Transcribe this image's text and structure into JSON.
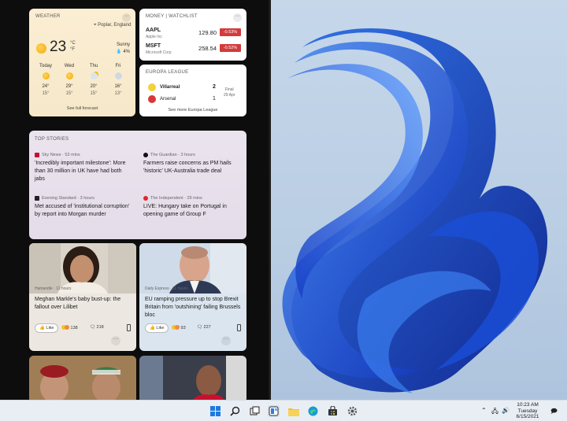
{
  "weather": {
    "header": "WEATHER",
    "location": "Poplar, England",
    "temp": "23",
    "unit_c": "°C",
    "unit_f": "°F",
    "condition": "Sunny",
    "precip": "4%",
    "forecast": [
      {
        "day": "Today",
        "icon": "sun-icon",
        "high": "24°",
        "low": "15°"
      },
      {
        "day": "Wed",
        "icon": "sun-icon",
        "high": "29°",
        "low": "15°"
      },
      {
        "day": "Thu",
        "icon": "partly-cloudy-icon",
        "high": "20°",
        "low": "15°"
      },
      {
        "day": "Fri",
        "icon": "rain-cloud-icon",
        "high": "16°",
        "low": "13°"
      }
    ],
    "link": "See full forecast"
  },
  "money": {
    "header": "MONEY | WATCHLIST",
    "stocks": [
      {
        "symbol": "AAPL",
        "name": "Apple Inc",
        "price": "129.80",
        "change": "-0.53%"
      },
      {
        "symbol": "MSFT",
        "name": "Microsoft Corp",
        "price": "258.54",
        "change": "-0.52%"
      }
    ],
    "down_color": "#d23b3b"
  },
  "sports": {
    "header": "EUROPA LEAGUE",
    "home": "Villarreal",
    "home_score": "2",
    "away": "Arsenal",
    "away_score": "1",
    "status": "Final",
    "date": "29 Apr",
    "link": "See more Europa League"
  },
  "stories": {
    "header": "TOP STORIES",
    "items": [
      {
        "source": "Sky News · 53 mins",
        "headline": "'Incredibly important milestone': More than 30 million in UK have had both jabs"
      },
      {
        "source": "The Guardian · 3 hours",
        "headline": "Farmers raise concerns as PM hails 'historic' UK-Australia trade deal"
      },
      {
        "source": "Evening Standard · 3 hours",
        "headline": "Met accused of 'institutional corruption' by report into Morgan murder"
      },
      {
        "source": "The Independent · 29 mins",
        "headline": "LIVE: Hungary take on Portugal in opening game of Group F"
      }
    ]
  },
  "news": [
    {
      "source": "Hamandle · 11 hours",
      "headline": "Meghan Markle's baby bust-up: the fallout over Lilibet",
      "like": "Like",
      "reactions": "138",
      "comments": "218"
    },
    {
      "source": "Daily Express · 11 hours",
      "headline": "EU ramping pressure up to stop Brexit Britain from 'outshining' failing Brussels bloc",
      "like": "Like",
      "reactions": "93",
      "comments": "227"
    }
  ],
  "taskbar": {
    "time": "10:23 AM",
    "day": "Tuesday",
    "date": "6/15/2021"
  }
}
